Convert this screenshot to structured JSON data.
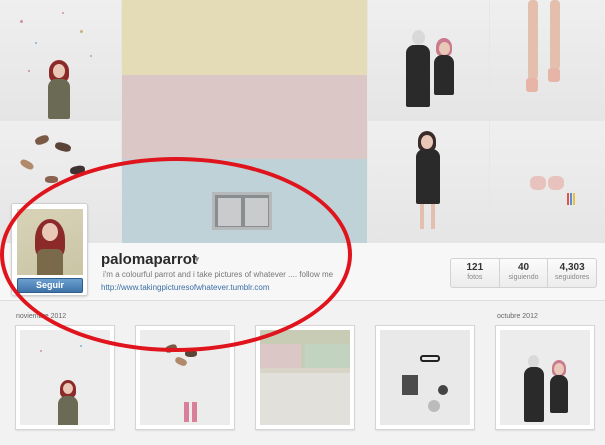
{
  "profile": {
    "username": "palomaparrot",
    "bio": "i'm a colourful parrot and i take pictures of whatever .... follow me",
    "link": "http://www.takingpicturesofwhatever.tumblr.com",
    "follow_label": "Seguir"
  },
  "stats": [
    {
      "value": "121",
      "label": "fotos"
    },
    {
      "value": "40",
      "label": "siguiendo"
    },
    {
      "value": "4,303",
      "label": "seguidores"
    }
  ],
  "months": [
    "noviembre 2012",
    "octubre 2012"
  ],
  "colors": {
    "follow": "#4a82bb",
    "link": "#3b6ea5",
    "annotation": "#e0141c"
  }
}
